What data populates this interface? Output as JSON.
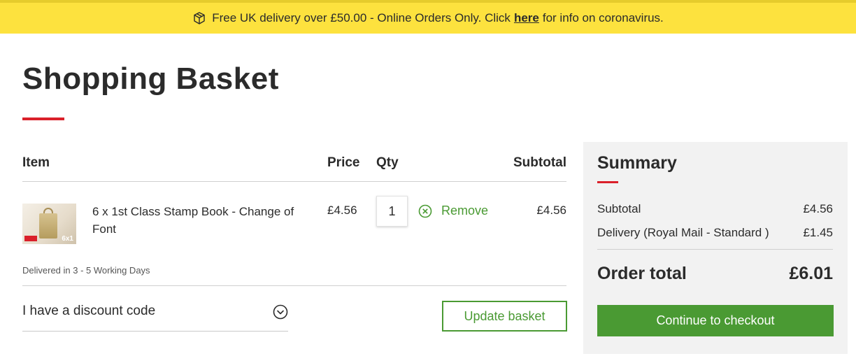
{
  "banner": {
    "icon": "package-box-icon",
    "text_before": "Free UK delivery over £50.00 - Online Orders Only. Click",
    "link_text": "here",
    "text_after": "for info on coronavirus."
  },
  "page": {
    "title": "Shopping Basket"
  },
  "basket": {
    "headers": {
      "item": "Item",
      "price": "Price",
      "qty": "Qty",
      "subtotal": "Subtotal"
    },
    "items": [
      {
        "image_icon": "stamp-book-thumbnail",
        "thumb_badge": "6x1",
        "name": "6 x 1st Class Stamp Book - Change of Font",
        "price": "£4.56",
        "qty": "1",
        "remove_label": "Remove",
        "subtotal": "£4.56"
      }
    ],
    "delivery_note": "Delivered in 3 - 5 Working Days",
    "discount_label": "I have a discount code",
    "update_button": "Update basket"
  },
  "summary": {
    "title": "Summary",
    "subtotal_label": "Subtotal",
    "subtotal_value": "£4.56",
    "delivery_label": "Delivery (Royal Mail - Standard )",
    "delivery_value": "£1.45",
    "total_label": "Order total",
    "total_value": "£6.01",
    "checkout_button": "Continue to checkout"
  },
  "colors": {
    "banner_bg": "#fde23e",
    "accent_red": "#da202a",
    "action_green": "#4a9a33",
    "summary_bg": "#f2f2f2"
  }
}
